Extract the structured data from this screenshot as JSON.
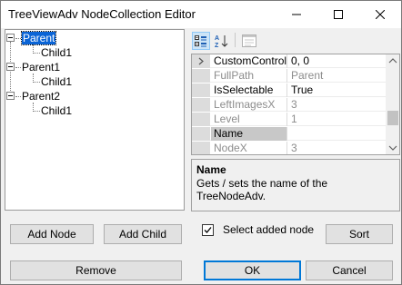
{
  "window": {
    "title": "TreeViewAdv NodeCollection Editor"
  },
  "tree": {
    "nodes": [
      {
        "label": "Parent",
        "selected": true,
        "child": "Child1"
      },
      {
        "label": "Parent1",
        "selected": false,
        "child": "Child1"
      },
      {
        "label": "Parent2",
        "selected": false,
        "child": "Child1"
      }
    ]
  },
  "grid": {
    "toolbar": [
      "categorized-icon",
      "alphabetical-icon",
      "property-pages-icon"
    ],
    "rows": [
      {
        "name": "CustomControlLo",
        "value": "0, 0",
        "readonly": false,
        "expand": true
      },
      {
        "name": "FullPath",
        "value": "Parent",
        "readonly": true,
        "expand": false
      },
      {
        "name": "IsSelectable",
        "value": "True",
        "readonly": false,
        "expand": false
      },
      {
        "name": "LeftImagesX",
        "value": "3",
        "readonly": true,
        "expand": false
      },
      {
        "name": "Level",
        "value": "1",
        "readonly": true,
        "expand": false
      },
      {
        "name": "Name",
        "value": "",
        "readonly": false,
        "expand": false,
        "selected": true
      },
      {
        "name": "NodeX",
        "value": "3",
        "readonly": true,
        "expand": false
      }
    ]
  },
  "help": {
    "title": "Name",
    "description": "Gets / sets the name of the TreeNodeAdv."
  },
  "buttons": {
    "add_node": "Add Node",
    "add_child": "Add Child",
    "sort": "Sort",
    "remove": "Remove",
    "ok": "OK",
    "cancel": "Cancel"
  },
  "checkbox": {
    "label": "Select added node",
    "checked": true
  }
}
